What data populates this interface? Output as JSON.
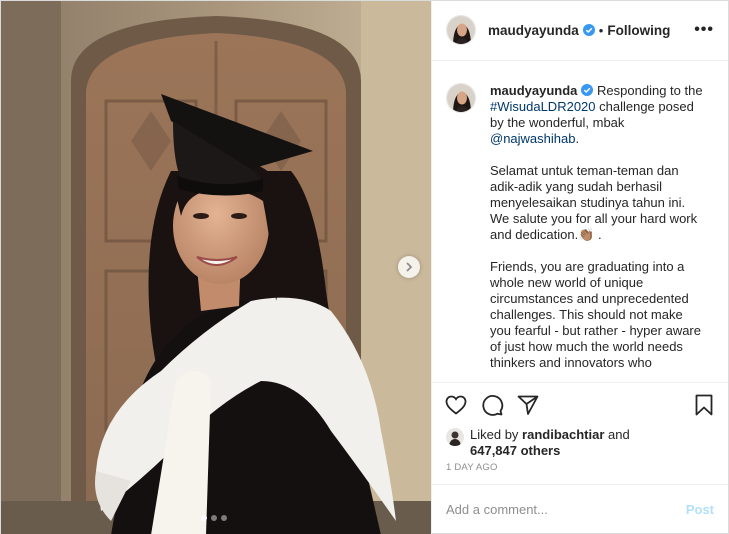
{
  "post": {
    "username": "maudyayunda",
    "separator": "•",
    "follow_status": "Following",
    "more_label": "•••"
  },
  "caption": {
    "username": "maudyayunda",
    "intro": " Responding to the ",
    "hashtag": "#WisudaLDR2020",
    "intro2": " challenge posed by the wonderful, mbak ",
    "mention": "@najwashihab",
    "intro3": ".",
    "para2": "Selamat untuk teman-teman dan adik-adik yang sudah berhasil menyelesaikan studinya tahun ini. We salute you for all your hard work and dedication.👏🏽 .",
    "para3": "Friends, you are graduating into a whole new world of unique circumstances and unprecedented challenges. This should not make you fearful - but rather - hyper aware of just how much the world needs thinkers and innovators who"
  },
  "likes": {
    "prefix": "Liked by ",
    "user": "randibachtiar",
    "and": " and",
    "others": "647,847 others"
  },
  "timestamp": "1 DAY AGO",
  "comment": {
    "placeholder": "Add a comment...",
    "post_label": "Post"
  },
  "carousel": {
    "slide_count": 3,
    "active_index": 0
  },
  "colors": {
    "link": "#00376b",
    "verified": "#3897f0",
    "post_disabled": "#b2dffc"
  }
}
